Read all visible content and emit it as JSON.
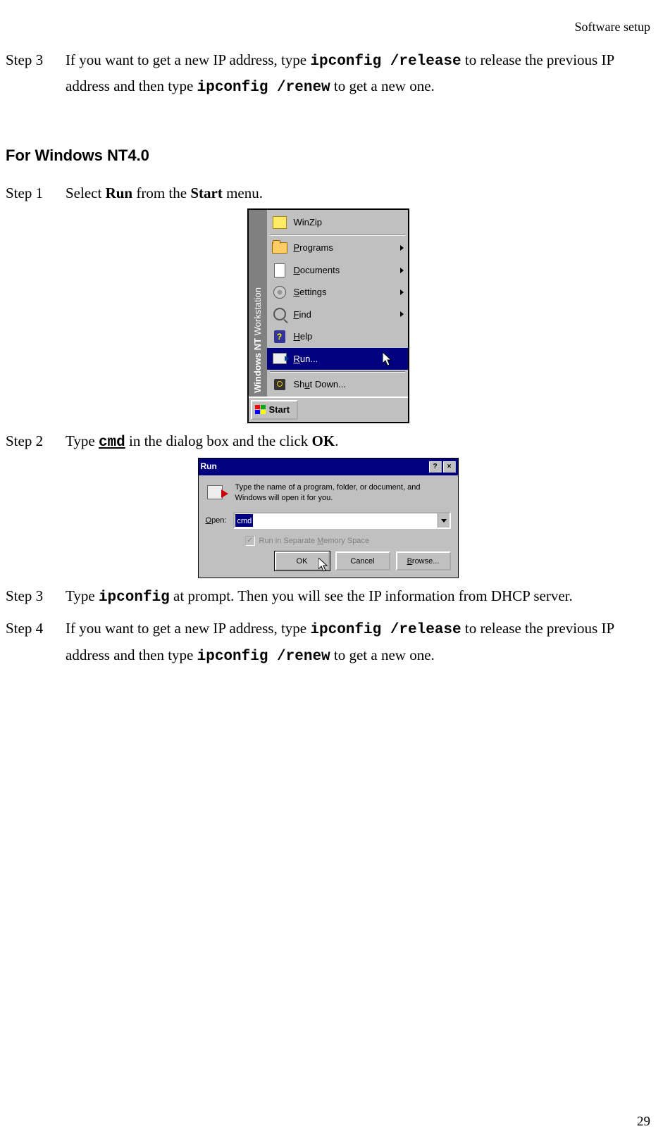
{
  "header": {
    "running_title": "Software  setup"
  },
  "step3_top": {
    "label": "Step 3",
    "pre": "If you want to get a new IP address, type ",
    "cmd1": "ipconfig /release",
    "mid": " to release the previous IP address and then type ",
    "cmd2": "ipconfig /renew",
    "post": "  to get a new one."
  },
  "section_nt4": {
    "title": "For Windows NT4.0"
  },
  "step1": {
    "label": "Step 1",
    "pre": "Select ",
    "b1": "Run",
    "mid": " from the ",
    "b2": "Start",
    "post": " menu."
  },
  "startmenu": {
    "side_brand": "Windows NT",
    "side_rest": " Workstation",
    "items": {
      "winzip": "WinZip",
      "programs_u": "P",
      "programs_rest": "rograms",
      "documents_u": "D",
      "documents_rest": "ocuments",
      "settings_u": "S",
      "settings_rest": "ettings",
      "find_u": "F",
      "find_rest": "ind",
      "help_u": "H",
      "help_rest": "elp",
      "run_u": "R",
      "run_rest": "un...",
      "shutdown_pre": "Sh",
      "shutdown_u": "u",
      "shutdown_rest": "t Down..."
    },
    "start_button": "Start"
  },
  "step2": {
    "label": "Step 2",
    "pre": "Type ",
    "cmd": "cmd",
    "mid": " in the dialog box and the click ",
    "b": "OK",
    "post": "."
  },
  "rundlg": {
    "title": "Run",
    "help_btn": "?",
    "close_btn": "×",
    "desc": "Type the name of a program, folder, or document, and Windows will open it for you.",
    "open_label_u": "O",
    "open_label_rest": "pen:",
    "input_value": "cmd",
    "chk_pre": "Run in Separate ",
    "chk_u": "M",
    "chk_rest": "emory Space",
    "ok": "OK",
    "cancel": "Cancel",
    "browse_u": "B",
    "browse_rest": "rowse..."
  },
  "step3_bottom": {
    "label": "Step 3",
    "pre": "Type ",
    "cmd": "ipconfig",
    "post1": " at prompt. Then you will see the IP information from DHCP server."
  },
  "step4": {
    "label": "Step 4",
    "pre": "If you want to get a new IP address, type ",
    "cmd1": "ipconfig /release",
    "mid": " to release the previous IP address and then type ",
    "cmd2": "ipconfig /renew",
    "post": "  to get a new one."
  },
  "page_number": "29"
}
